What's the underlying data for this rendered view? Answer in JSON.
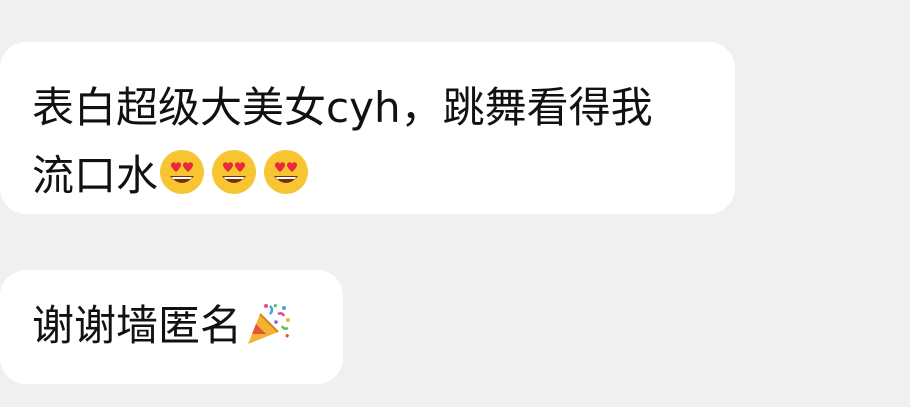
{
  "messages": [
    {
      "line1": "表白超级大美女cyh，跳舞看得我",
      "line2": "流口水",
      "emojis": [
        "heart-eyes-icon",
        "heart-eyes-icon",
        "heart-eyes-icon"
      ]
    },
    {
      "text": "谢谢墙匿名",
      "emojis": [
        "party-popper-icon"
      ]
    }
  ],
  "colors": {
    "background": "#f0f0f0",
    "bubble": "#ffffff",
    "text": "#111111"
  }
}
